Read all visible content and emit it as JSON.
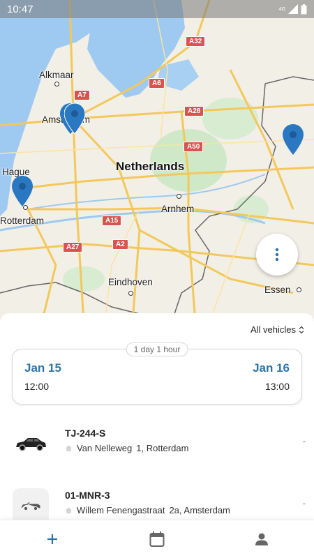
{
  "status_bar": {
    "time": "10:47",
    "network": "4G"
  },
  "map": {
    "country_label": "Netherlands",
    "cities": {
      "alkmaar": "Alkmaar",
      "amsterdam": "Amsterdam",
      "hague": "Hague",
      "rotterdam": "Rotterdam",
      "arnhem": "Arnhem",
      "eindhoven": "Eindhoven",
      "essen": "Essen"
    },
    "roads": {
      "a32": "A32",
      "a7": "A7",
      "a6": "A6",
      "a28": "A28",
      "a50": "A50",
      "a15": "A15",
      "a2": "A2",
      "a27": "A27"
    },
    "pin_color": "#2a78c2"
  },
  "filter": {
    "label": "All vehicles"
  },
  "booking": {
    "duration": "1 day 1 hour",
    "start_date": "Jan 15",
    "start_time": "12:00",
    "end_date": "Jan 16",
    "end_time": "13:00"
  },
  "vehicles": [
    {
      "plate": "TJ-244-S",
      "street": "Van Nelleweg",
      "address_rest": "1, Rotterdam",
      "availability": "-",
      "icon": "car-icon"
    },
    {
      "plate": "01-MNR-3",
      "street": "Willem Fenengastraat",
      "address_rest": "2a, Amsterdam",
      "availability": "-",
      "icon": "convertible-icon"
    }
  ],
  "nav": {
    "items": [
      "add-icon",
      "calendar-icon",
      "profile-icon"
    ]
  },
  "colors": {
    "accent": "#2c74a8",
    "water": "#9ec9f0",
    "land": "#f2efe6",
    "park": "#cfe8c8"
  }
}
